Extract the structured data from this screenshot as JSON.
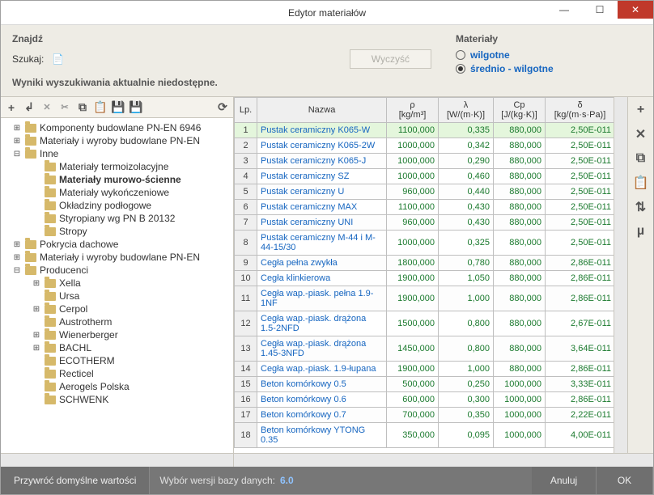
{
  "window": {
    "title": "Edytor materiałów"
  },
  "find": {
    "heading": "Znajdź",
    "search_label": "Szukaj:",
    "clear_btn": "Wyczyść",
    "no_results": "Wyniki wyszukiwania aktualnie niedostępne."
  },
  "materials": {
    "heading": "Materiały",
    "opt_moist": "wilgotne",
    "opt_medium": "średnio - wilgotne",
    "selected": "medium"
  },
  "tree": [
    {
      "d": 0,
      "exp": "+",
      "label": "Komponenty budowlane PN-EN 6946"
    },
    {
      "d": 0,
      "exp": "+",
      "label": "Materiały i wyroby budowlane PN-EN"
    },
    {
      "d": 0,
      "exp": "-",
      "label": "Inne"
    },
    {
      "d": 1,
      "exp": "",
      "label": "Materiały termoizolacyjne"
    },
    {
      "d": 1,
      "exp": "",
      "label": "Materiały murowo-ścienne",
      "bold": true
    },
    {
      "d": 1,
      "exp": "",
      "label": "Materiały wykończeniowe"
    },
    {
      "d": 1,
      "exp": "",
      "label": "Okładziny podłogowe"
    },
    {
      "d": 1,
      "exp": "",
      "label": "Styropiany wg PN B 20132"
    },
    {
      "d": 1,
      "exp": "",
      "label": "Stropy"
    },
    {
      "d": 0,
      "exp": "+",
      "label": "Pokrycia dachowe"
    },
    {
      "d": 0,
      "exp": "+",
      "label": "Materiały i wyroby budowlane PN-EN"
    },
    {
      "d": 0,
      "exp": "-",
      "label": "Producenci"
    },
    {
      "d": 1,
      "exp": "+",
      "label": "Xella"
    },
    {
      "d": 1,
      "exp": "",
      "label": "Ursa"
    },
    {
      "d": 1,
      "exp": "+",
      "label": "Cerpol"
    },
    {
      "d": 1,
      "exp": "",
      "label": "Austrotherm"
    },
    {
      "d": 1,
      "exp": "+",
      "label": "Wienerberger"
    },
    {
      "d": 1,
      "exp": "+",
      "label": "BACHL"
    },
    {
      "d": 1,
      "exp": "",
      "label": "ECOTHERM"
    },
    {
      "d": 1,
      "exp": "",
      "label": "Recticel"
    },
    {
      "d": 1,
      "exp": "",
      "label": "Aerogels Polska"
    },
    {
      "d": 1,
      "exp": "",
      "label": "SCHWENK"
    }
  ],
  "table": {
    "headers": {
      "lp": "Lp.",
      "name": "Nazwa",
      "rho": "ρ",
      "rho_u": "[kg/m³]",
      "lambda": "λ",
      "lambda_u": "[W/(m·K)]",
      "cp": "Cp",
      "cp_u": "[J/(kg·K)]",
      "delta": "δ",
      "delta_u": "[kg/(m·s·Pa)]"
    },
    "rows": [
      {
        "lp": 1,
        "name": "Pustak ceramiczny K065-W",
        "rho": "1100,000",
        "lambda": "0,335",
        "cp": "880,000",
        "delta": "2,50E-011",
        "sel": true
      },
      {
        "lp": 2,
        "name": "Pustak ceramiczny K065-2W",
        "rho": "1000,000",
        "lambda": "0,342",
        "cp": "880,000",
        "delta": "2,50E-011"
      },
      {
        "lp": 3,
        "name": "Pustak ceramiczny K065-J",
        "rho": "1000,000",
        "lambda": "0,290",
        "cp": "880,000",
        "delta": "2,50E-011"
      },
      {
        "lp": 4,
        "name": "Pustak ceramiczny SZ",
        "rho": "1000,000",
        "lambda": "0,460",
        "cp": "880,000",
        "delta": "2,50E-011"
      },
      {
        "lp": 5,
        "name": "Pustak ceramiczny U",
        "rho": "960,000",
        "lambda": "0,440",
        "cp": "880,000",
        "delta": "2,50E-011"
      },
      {
        "lp": 6,
        "name": "Pustak ceramiczny MAX",
        "rho": "1100,000",
        "lambda": "0,430",
        "cp": "880,000",
        "delta": "2,50E-011"
      },
      {
        "lp": 7,
        "name": "Pustak ceramiczny UNI",
        "rho": "960,000",
        "lambda": "0,430",
        "cp": "880,000",
        "delta": "2,50E-011"
      },
      {
        "lp": 8,
        "name": "Pustak ceramiczny M-44 i M-44-15/30",
        "rho": "1000,000",
        "lambda": "0,325",
        "cp": "880,000",
        "delta": "2,50E-011"
      },
      {
        "lp": 9,
        "name": "Cegła pełna zwykła",
        "rho": "1800,000",
        "lambda": "0,780",
        "cp": "880,000",
        "delta": "2,86E-011"
      },
      {
        "lp": 10,
        "name": "Cegła klinkierowa",
        "rho": "1900,000",
        "lambda": "1,050",
        "cp": "880,000",
        "delta": "2,86E-011"
      },
      {
        "lp": 11,
        "name": "Cegła wap.-piask. pełna 1.9-1NF",
        "rho": "1900,000",
        "lambda": "1,000",
        "cp": "880,000",
        "delta": "2,86E-011"
      },
      {
        "lp": 12,
        "name": "Cegła wap.-piask. drążona 1.5-2NFD",
        "rho": "1500,000",
        "lambda": "0,800",
        "cp": "880,000",
        "delta": "2,67E-011"
      },
      {
        "lp": 13,
        "name": "Cegła wap.-piask. drążona 1.45-3NFD",
        "rho": "1450,000",
        "lambda": "0,800",
        "cp": "880,000",
        "delta": "3,64E-011"
      },
      {
        "lp": 14,
        "name": "Cegła wap.-piask. 1.9-łupana",
        "rho": "1900,000",
        "lambda": "1,000",
        "cp": "880,000",
        "delta": "2,86E-011"
      },
      {
        "lp": 15,
        "name": "Beton komórkowy 0.5",
        "rho": "500,000",
        "lambda": "0,250",
        "cp": "1000,000",
        "delta": "3,33E-011"
      },
      {
        "lp": 16,
        "name": "Beton komórkowy 0.6",
        "rho": "600,000",
        "lambda": "0,300",
        "cp": "1000,000",
        "delta": "2,86E-011"
      },
      {
        "lp": 17,
        "name": "Beton komórkowy 0.7",
        "rho": "700,000",
        "lambda": "0,350",
        "cp": "1000,000",
        "delta": "2,22E-011"
      },
      {
        "lp": 18,
        "name": "Beton komórkowy YTONG 0.35",
        "rho": "350,000",
        "lambda": "0,095",
        "cp": "1000,000",
        "delta": "4,00E-011"
      }
    ]
  },
  "footer": {
    "restore": "Przywróć domyślne wartości",
    "version_label": "Wybór wersji bazy danych:",
    "version": "6.0",
    "cancel": "Anuluj",
    "ok": "OK"
  }
}
